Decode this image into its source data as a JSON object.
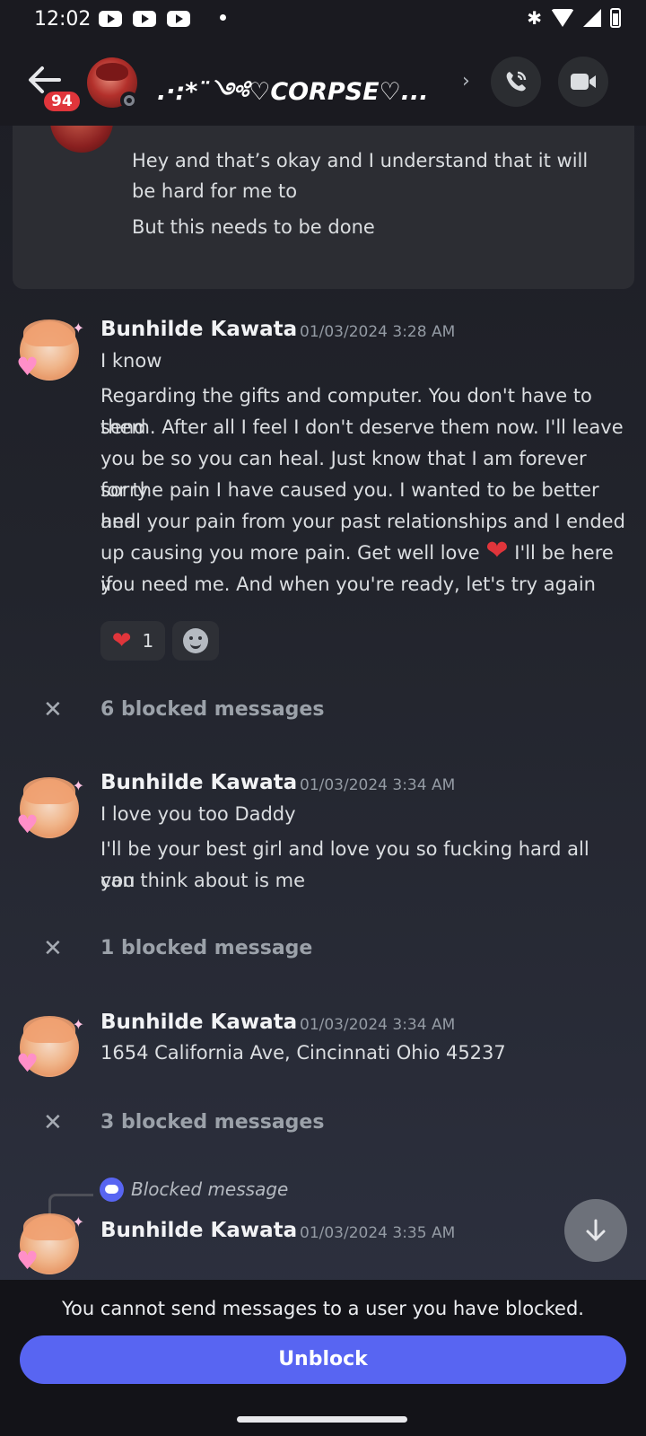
{
  "status_bar": {
    "time": "12:02"
  },
  "header": {
    "unread_badge": "94",
    "channel_name": ".·:*¨༺♡CORPSE♡...",
    "chevron": "›"
  },
  "reply_card": {
    "lines": [
      "Hey and that’s okay  and I understand  that it will",
      "be hard for me to",
      "But this needs to be done"
    ]
  },
  "messages": [
    {
      "author": "Bunhilde Kawata",
      "timestamp": "01/03/2024 3:28 AM",
      "lines": [
        "I know",
        "Regarding the gifts and computer. You don't have to send",
        "them. After all I feel I don't deserve them now. I'll leave",
        "you be so you can heal. Just know that I am forever sorry",
        "for the pain I have caused you. I wanted to be better and",
        "heal your pain from your past relationships and I ended",
        "up causing you more pain. Get well love",
        "I'll be here if",
        "you need me. And when you're ready, let's try again"
      ],
      "reaction": {
        "emoji": "heart",
        "count": "1"
      }
    },
    {
      "author": "Bunhilde Kawata",
      "timestamp": "01/03/2024 3:34 AM",
      "lines": [
        "I love you too Daddy",
        "I'll be your best girl and love you so fucking hard all you",
        "can think about is me"
      ]
    },
    {
      "author": "Bunhilde Kawata",
      "timestamp": "01/03/2024 3:34 AM",
      "lines": [
        "1654 California Ave, Cincinnati Ohio 45237"
      ]
    },
    {
      "author": "Bunhilde Kawata",
      "timestamp": "01/03/2024 3:35 AM",
      "reply_to": "Blocked message"
    }
  ],
  "blocked_groups": [
    "6 blocked messages",
    "1 blocked message",
    "3 blocked messages"
  ],
  "footer": {
    "notice": "You cannot send messages to a user you have blocked.",
    "unblock_label": "Unblock"
  },
  "colors": {
    "accent": "#5865f2",
    "badge": "#e0353b",
    "heart": "#e0353b",
    "background": "#22242c"
  },
  "icons": [
    "back-arrow-icon",
    "phone-call-icon",
    "video-camera-icon",
    "close-icon",
    "heart-icon",
    "add-reaction-icon",
    "discord-logo-icon",
    "arrow-down-icon"
  ]
}
